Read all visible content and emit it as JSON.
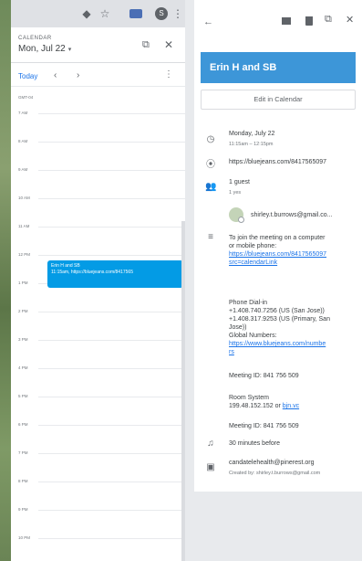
{
  "left": {
    "label": "CALENDAR",
    "date": "Mon, Jul 22",
    "today_btn": "Today",
    "timezone": "GMT-04",
    "hours": [
      "7 AM",
      "8 AM",
      "9 AM",
      "10 AM",
      "11 AM",
      "12 PM",
      "1 PM",
      "2 PM",
      "3 PM",
      "4 PM",
      "5 PM",
      "6 PM",
      "7 PM",
      "8 PM",
      "9 PM",
      "10 PM"
    ],
    "event": {
      "title": "Erin H and SB",
      "subtitle": "11:15am, https://bluejeans.com/8417565"
    }
  },
  "detail": {
    "title": "Erin H and SB",
    "edit_btn": "Edit in Calendar",
    "date": "Monday, July 22",
    "time": "11:15am – 12:15pm",
    "location": "https://bluejeans.com/8417565097",
    "guests_count": "1 guest",
    "guests_yes": "1 yes",
    "guest_email": "shirley.t.burrows@gmail.co...",
    "desc_intro_1": "To join the meeting on a computer",
    "desc_intro_2": "or mobile phone:",
    "desc_link_1": "https://bluejeans.com/8417565097",
    "desc_link_2": "src=calendarLink",
    "phone_label": "Phone Dial-in",
    "phone_1": "+1.408.740.7256 (US (San Jose))",
    "phone_2": "+1.408.317.9253 (US (Primary, San",
    "phone_2b": "Jose))",
    "global_label": "Global Numbers:",
    "global_link_1": "https://www.bluejeans.com/numbe",
    "global_link_2": "rs",
    "meeting_id_1": "Meeting ID: 841 756 509",
    "room_label": "Room System",
    "room_ip": "199.48.152.152 or ",
    "room_link": "bjn.vc",
    "meeting_id_2": "Meeting ID: 841 756 509",
    "reminder": "30 minutes before",
    "organizer": "candatelehealth@pinerest.org",
    "created_by": "Created by: shirley.t.burrows@gmail.com"
  }
}
